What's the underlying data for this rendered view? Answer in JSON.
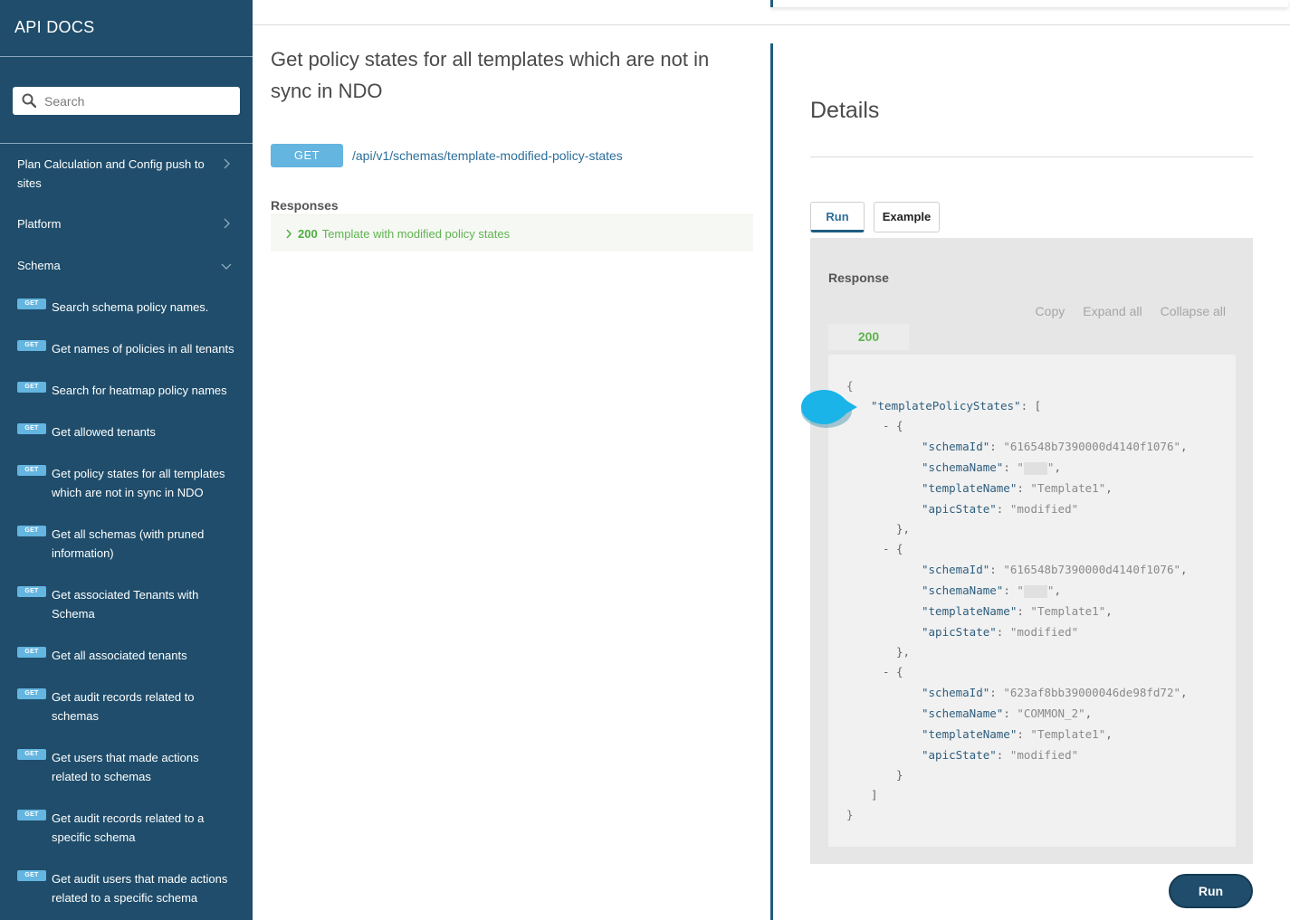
{
  "sidebar": {
    "title": "API DOCS",
    "search_placeholder": "Search",
    "categories": [
      {
        "label": "Plan Calculation and Config push to sites",
        "chevron": "chevron-right"
      },
      {
        "label": "Platform",
        "chevron": "chevron-right"
      },
      {
        "label": "Schema",
        "chevron": "chevron-down"
      }
    ],
    "endpoints": [
      {
        "method": "GET",
        "label": "Search schema policy names."
      },
      {
        "method": "GET",
        "label": "Get names of policies in all tenants"
      },
      {
        "method": "GET",
        "label": "Search for heatmap policy names"
      },
      {
        "method": "GET",
        "label": "Get allowed tenants"
      },
      {
        "method": "GET",
        "label": "Get policy states for all templates which are not in sync in NDO"
      },
      {
        "method": "GET",
        "label": "Get all schemas (with pruned information)"
      },
      {
        "method": "GET",
        "label": "Get associated Tenants with Schema"
      },
      {
        "method": "GET",
        "label": "Get all associated tenants"
      },
      {
        "method": "GET",
        "label": "Get audit records related to schemas"
      },
      {
        "method": "GET",
        "label": "Get users that made actions related to schemas"
      },
      {
        "method": "GET",
        "label": "Get audit records related to a specific schema"
      },
      {
        "method": "GET",
        "label": "Get audit users that made actions related to a specific schema"
      }
    ]
  },
  "main": {
    "title": "Get policy states for all templates which are not in sync in NDO",
    "method": "GET",
    "path": "/api/v1/schemas/template-modified-policy-states",
    "responses_label": "Responses",
    "response_code": "200",
    "response_desc": "Template with modified policy states"
  },
  "details": {
    "title": "Details",
    "tabs": {
      "run": "Run",
      "example": "Example"
    },
    "response_label": "Response",
    "actions": {
      "copy": "Copy",
      "expand": "Expand all",
      "collapse": "Collapse all"
    },
    "status": "200",
    "json": {
      "open": "{",
      "close": "}",
      "root_key": "templatePolicyStates",
      "items": [
        {
          "schemaId": "616548b7390000d4140f1076",
          "schemaName": "",
          "templateName": "Template1",
          "apicState": "modified"
        },
        {
          "schemaId": "616548b7390000d4140f1076",
          "schemaName": "",
          "templateName": "Template1",
          "apicState": "modified"
        },
        {
          "schemaId": "623af8bb39000046de98fd72",
          "schemaName": "COMMON_2",
          "templateName": "Template1",
          "apicState": "modified"
        }
      ]
    },
    "run_button": "Run"
  },
  "colors": {
    "sidebar_bg": "#1f4d6b",
    "accent": "#1f5d80",
    "get_badge": "#64b5e0",
    "success": "#5fb34f",
    "marker": "#1ab4e8"
  }
}
